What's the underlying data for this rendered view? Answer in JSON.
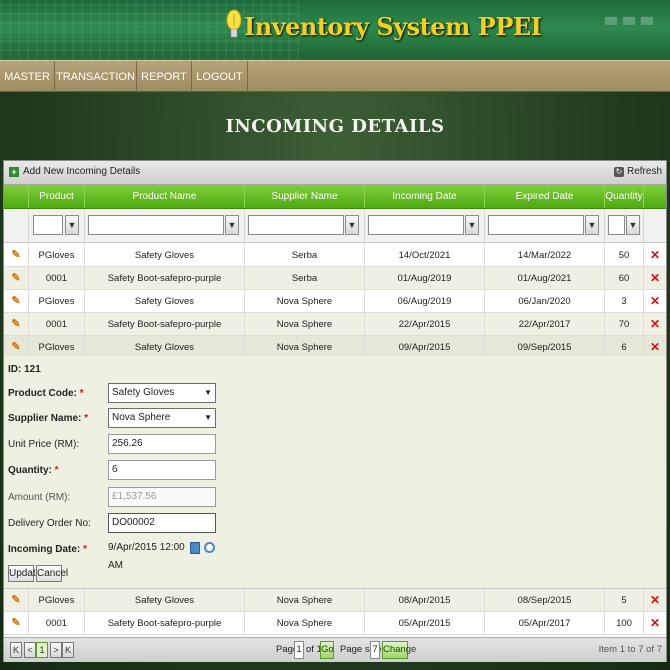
{
  "app": {
    "title": "Inventory System PPEI"
  },
  "menu": [
    {
      "label": "MASTER"
    },
    {
      "label": "TRANSACTION"
    },
    {
      "label": "REPORT"
    },
    {
      "label": "LOGOUT"
    }
  ],
  "page": {
    "title": "INCOMING DETAILS"
  },
  "toolbar": {
    "add_label": "Add New Incoming Details",
    "refresh_label": "Refresh"
  },
  "grid": {
    "columns": [
      "Product Code",
      "Product Name",
      "Supplier Name",
      "Incoming Date",
      "Expired Date",
      "Quantity"
    ],
    "filter_icon": "filter-icon",
    "rows_top": [
      {
        "code": "PGloves",
        "name": "Safety Gloves",
        "supplier": "Serba",
        "incoming": "14/Oct/2021",
        "expired": "14/Mar/2022",
        "qty": "50"
      },
      {
        "code": "0001",
        "name": "Safety Boot-safepro-purple",
        "supplier": "Serba",
        "incoming": "01/Aug/2019",
        "expired": "01/Aug/2021",
        "qty": "60"
      },
      {
        "code": "PGloves",
        "name": "Safety Gloves",
        "supplier": "Nova Sphere",
        "incoming": "06/Aug/2019",
        "expired": "06/Jan/2020",
        "qty": "3"
      },
      {
        "code": "0001",
        "name": "Safety Boot-safepro-purple",
        "supplier": "Nova Sphere",
        "incoming": "22/Apr/2015",
        "expired": "22/Apr/2017",
        "qty": "70"
      },
      {
        "code": "PGloves",
        "name": "Safety Gloves",
        "supplier": "Nova Sphere",
        "incoming": "09/Apr/2015",
        "expired": "09/Sep/2015",
        "qty": "6"
      }
    ],
    "rows_bottom": [
      {
        "code": "PGloves",
        "name": "Safety Gloves",
        "supplier": "Nova Sphere",
        "incoming": "08/Apr/2015",
        "expired": "08/Sep/2015",
        "qty": "5"
      },
      {
        "code": "0001",
        "name": "Safety Boot-safepro-purple",
        "supplier": "Nova Sphere",
        "incoming": "05/Apr/2015",
        "expired": "05/Apr/2017",
        "qty": "100"
      }
    ]
  },
  "edit_form": {
    "id_label": "ID: 121",
    "product_code_label": "Product Code:",
    "product_code_value": "Safety Gloves",
    "supplier_name_label": "Supplier Name:",
    "supplier_name_value": "Nova Sphere",
    "unit_price_label": "Unit Price (RM):",
    "unit_price_value": "256.26",
    "quantity_label": "Quantity:",
    "quantity_value": "6",
    "amount_label": "Amount (RM):",
    "amount_value": "£1,537.56",
    "delivery_order_label": "Delivery Order No:",
    "delivery_order_value": "DO00002",
    "incoming_date_label": "Incoming Date:",
    "incoming_date_value": "9/Apr/2015 12:00 AM",
    "required_mark": "*",
    "update_label": "Update",
    "cancel_label": "Cancel"
  },
  "pager": {
    "current_page": "1",
    "page_label": "Page:",
    "of_label": "of 1",
    "go_label": "Go",
    "page_size_label": "Page size:",
    "page_size_value": "7",
    "change_label": "Change",
    "items_label": "Item 1 to 7 of 7"
  },
  "colors": {
    "header_green": "#5bb51d",
    "menu_tan": "#a8966a",
    "title_yellow": "#f2d024",
    "delete_red": "#d41414"
  }
}
